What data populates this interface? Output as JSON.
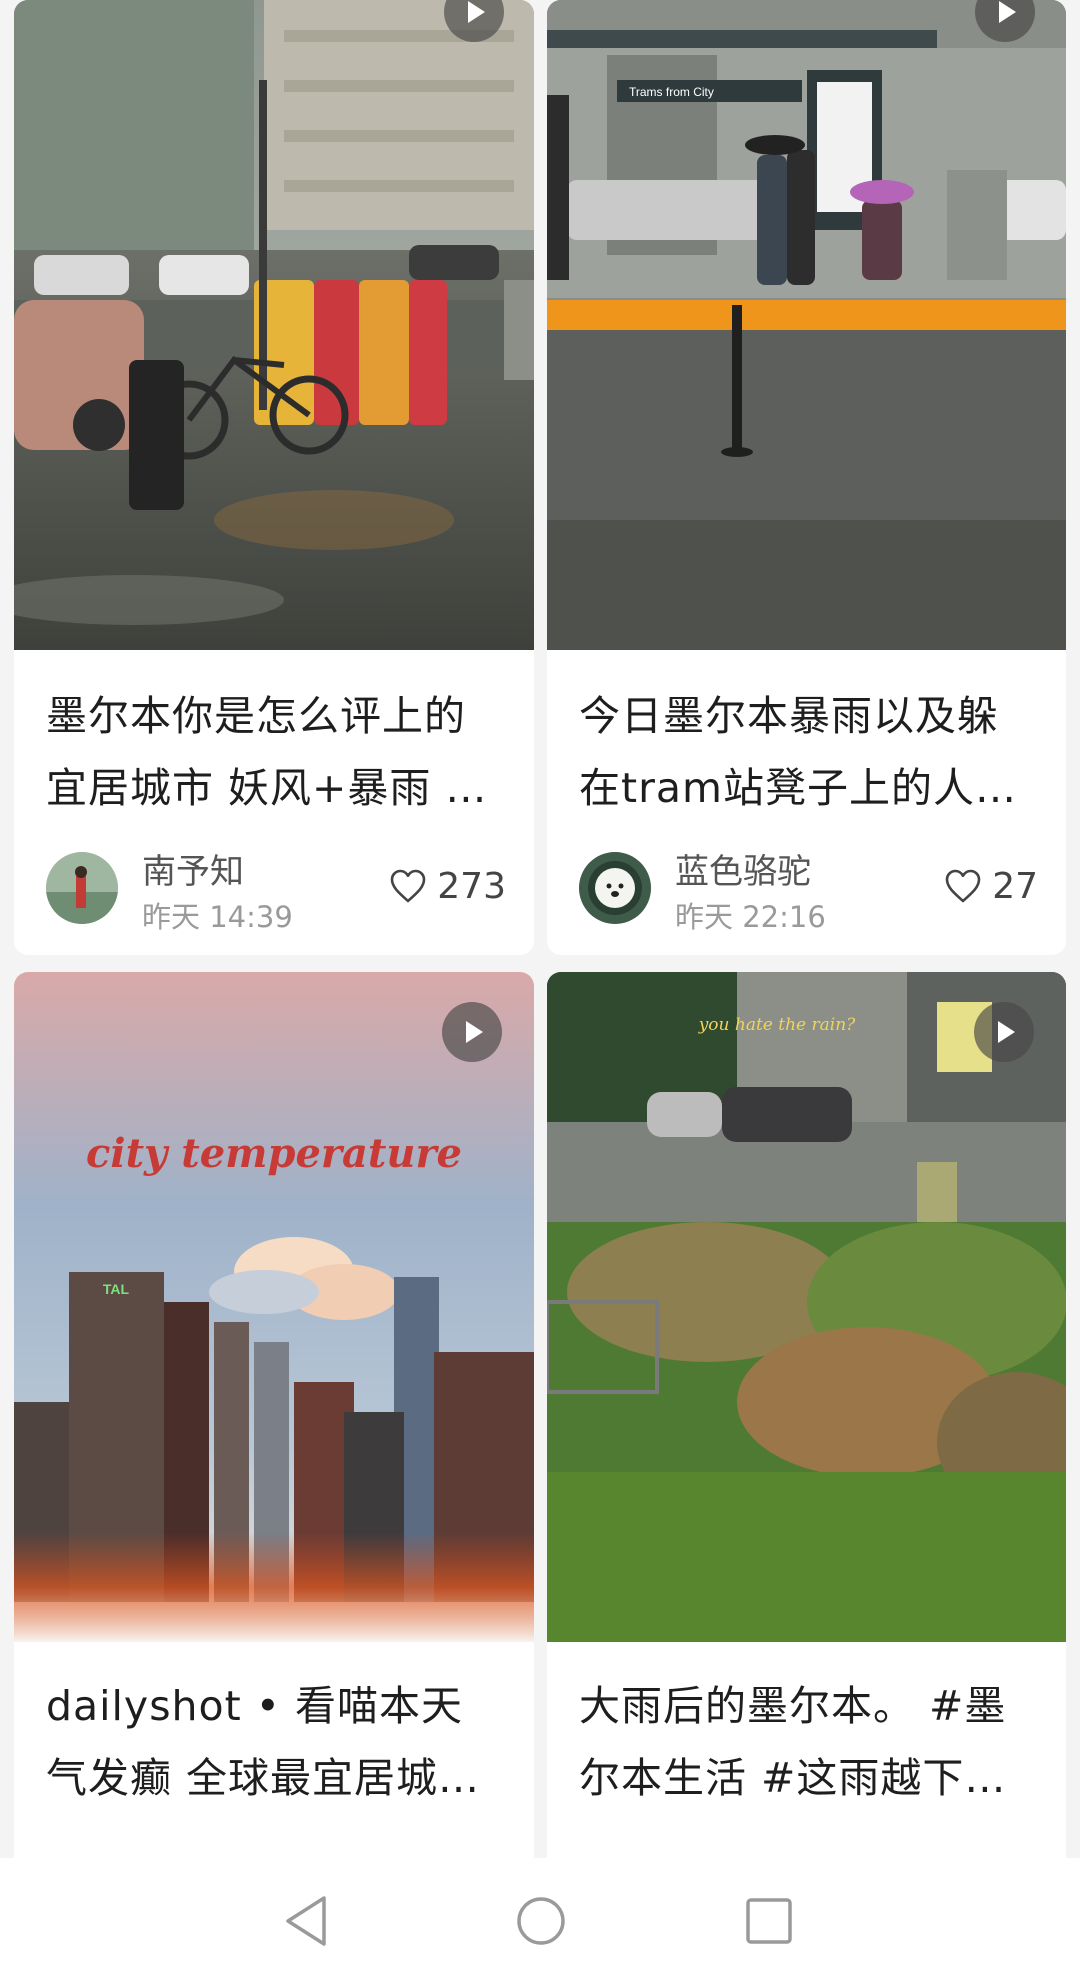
{
  "posts": [
    {
      "title_line1": "墨尔本你是怎么评上的",
      "title_line2": "宜居城市 妖风+暴雨 …",
      "author": "南予知",
      "time": "昨天 14:39",
      "likes": "273",
      "cover_kind": "video"
    },
    {
      "title_line1": "今日墨尔本暴雨以及躲",
      "title_line2": "在tram站凳子上的人…",
      "author": "蓝色骆驼",
      "time": "昨天 22:16",
      "likes": "27",
      "cover_kind": "video",
      "cover_sign": "Trams from City"
    },
    {
      "title_line1": "dailyshot • 看喵本天",
      "title_line2": "气发癫 全球最宜居城…",
      "cover_kind": "video",
      "cover_caption": "city temperature",
      "cover_building_sign": "TAL"
    },
    {
      "title_line1": "大雨后的墨尔本。 #墨",
      "title_line2": "尔本生活 #这雨越下…",
      "cover_kind": "video",
      "cover_caption": "you hate the rain?"
    }
  ],
  "icons": {
    "play": "play-icon",
    "heart": "heart-outline-icon",
    "nav_back": "triangle-back-icon",
    "nav_home": "circle-home-icon",
    "nav_recent": "square-recent-icon"
  },
  "colors": {
    "background": "#f4f4f4",
    "card": "#ffffff",
    "title_text": "#1e1e1e",
    "meta_text": "#9a9a9a",
    "accent_red": "#c0392b"
  }
}
